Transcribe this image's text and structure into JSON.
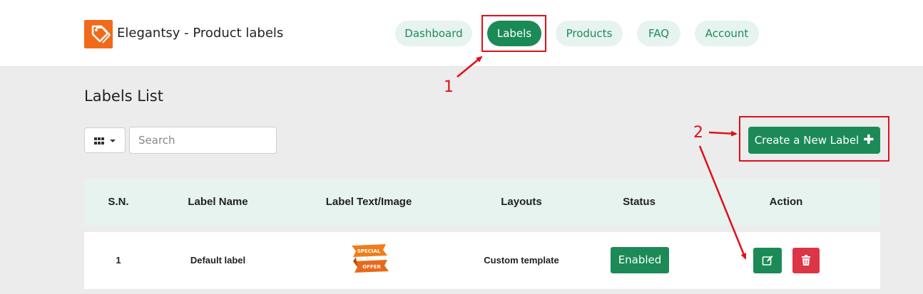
{
  "app": {
    "title": "Elegantsy - Product labels",
    "logo_icon": "price-tag-icon"
  },
  "nav": {
    "items": [
      {
        "label": "Dashboard",
        "active": false
      },
      {
        "label": "Labels",
        "active": true
      },
      {
        "label": "Products",
        "active": false
      },
      {
        "label": "FAQ",
        "active": false
      },
      {
        "label": "Account",
        "active": false
      }
    ]
  },
  "page": {
    "title": "Labels List"
  },
  "toolbar": {
    "view_toggle_icon": "grid-icon",
    "search_placeholder": "Search",
    "create_label": "Create a New Label",
    "create_icon": "plus-icon"
  },
  "table": {
    "headers": [
      "S.N.",
      "Label Name",
      "Label Text/Image",
      "Layouts",
      "Status",
      "Action"
    ],
    "rows": [
      {
        "sn": "1",
        "name": "Default label",
        "image_text": "SPECIAL OFFER",
        "layout": "Custom template",
        "status": "Enabled",
        "actions": [
          "edit-icon",
          "trash-icon"
        ]
      }
    ]
  },
  "annotations": {
    "one": "1",
    "two": "2"
  },
  "colors": {
    "accent": "#1b8a57",
    "pill_bg": "#e6f3ef",
    "danger": "#dc3545",
    "annotation_red": "#e0101a",
    "logo_orange": "#f06a1a"
  }
}
